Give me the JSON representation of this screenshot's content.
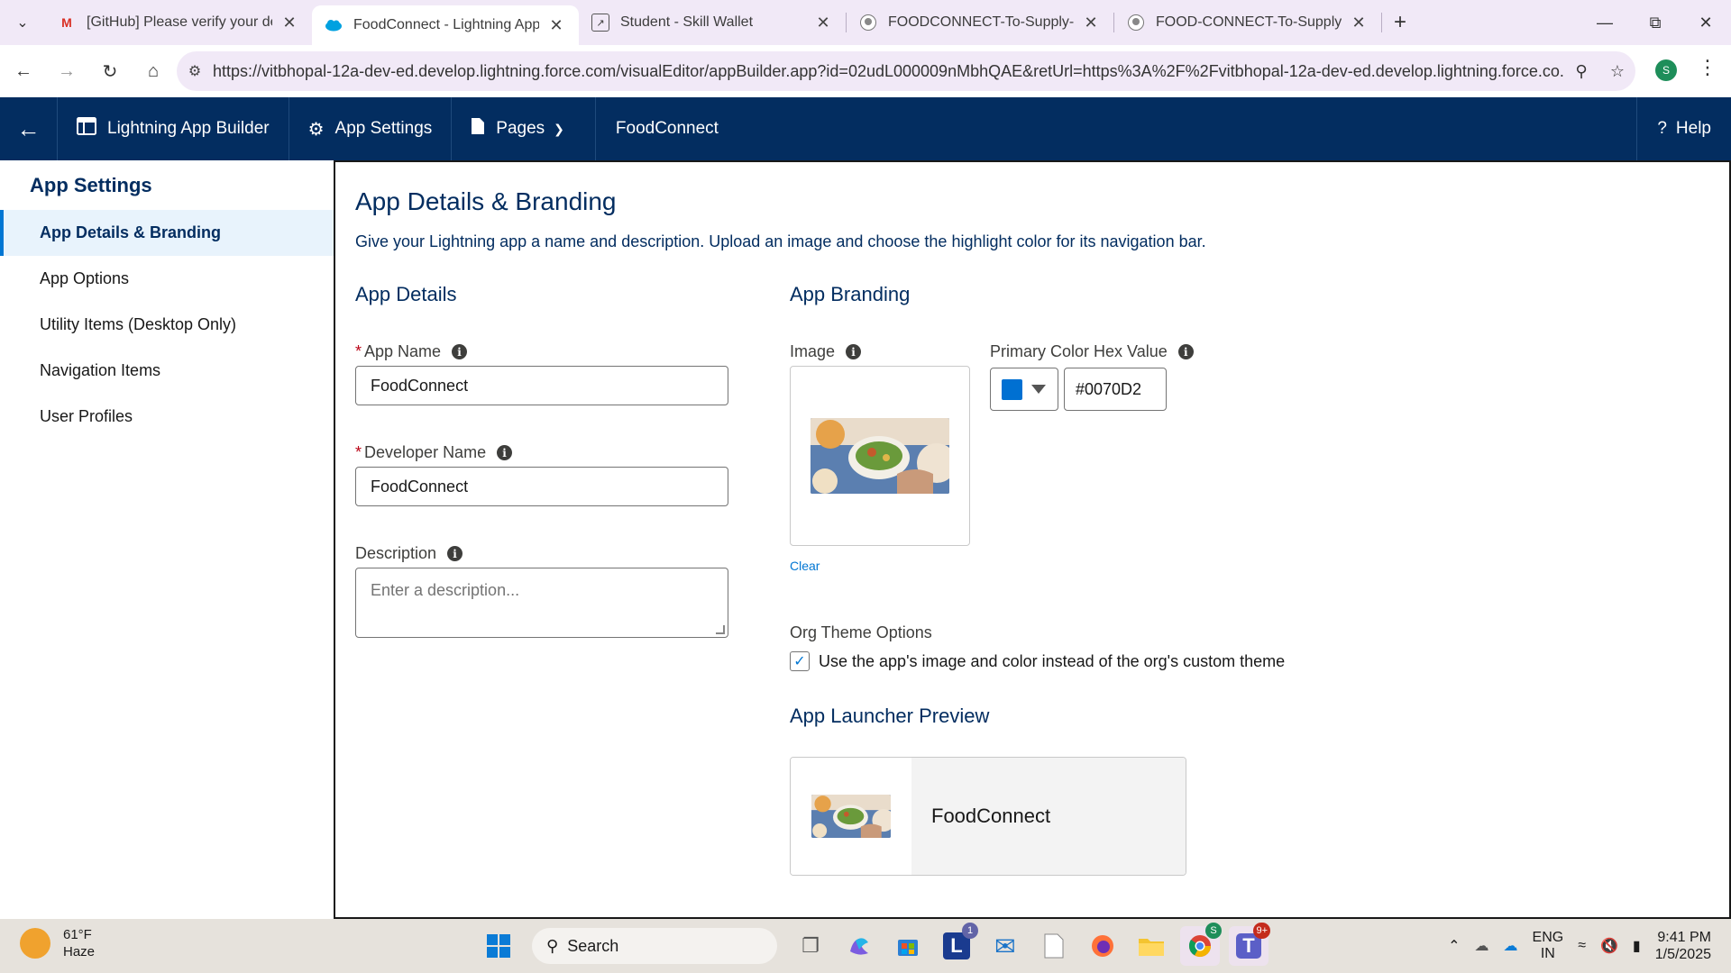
{
  "browser": {
    "tabs": [
      {
        "title": "[GitHub] Please verify your devi",
        "icon": "gmail-icon",
        "active": false
      },
      {
        "title": "FoodConnect - Lightning App B",
        "icon": "salesforce-cloud-icon",
        "active": true
      },
      {
        "title": "Student - Skill Wallet",
        "icon": "skill-wallet-icon",
        "active": false
      },
      {
        "title": "FOODCONNECT-To-Supply-Left",
        "icon": "github-icon",
        "active": false
      },
      {
        "title": "FOOD-CONNECT-To-Supply-Le",
        "icon": "github-icon",
        "active": false
      }
    ],
    "url": "https://vitbhopal-12a-dev-ed.develop.lightning.force.com/visualEditor/appBuilder.app?id=02udL000009nMbhQAE&retUrl=https%3A%2F%2Fvitbhopal-12a-dev-ed.develop.lightning.force.co...",
    "profile_initial": "S"
  },
  "header": {
    "builder_title": "Lightning App Builder",
    "app_settings_label": "App Settings",
    "pages_label": "Pages",
    "app_name": "FoodConnect",
    "help_label": "Help"
  },
  "sidebar": {
    "title": "App Settings",
    "items": [
      {
        "label": "App Details & Branding",
        "active": true
      },
      {
        "label": "App Options",
        "active": false
      },
      {
        "label": "Utility Items (Desktop Only)",
        "active": false
      },
      {
        "label": "Navigation Items",
        "active": false
      },
      {
        "label": "User Profiles",
        "active": false
      }
    ]
  },
  "main": {
    "title": "App Details & Branding",
    "intro": "Give your Lightning app a name and description. Upload an image and choose the highlight color for its navigation bar.",
    "details": {
      "section_title": "App Details",
      "app_name_label": "App Name",
      "app_name_value": "FoodConnect",
      "developer_name_label": "Developer Name",
      "developer_name_value": "FoodConnect",
      "description_label": "Description",
      "description_placeholder": "Enter a description..."
    },
    "branding": {
      "section_title": "App Branding",
      "image_label": "Image",
      "clear_label": "Clear",
      "color_label": "Primary Color Hex Value",
      "color_value": "#0070D2",
      "org_theme_label": "Org Theme Options",
      "org_theme_checkbox_label": "Use the app's image and color instead of the org's custom theme",
      "org_theme_checked": true,
      "preview_title": "App Launcher Preview",
      "preview_app_name": "FoodConnect"
    }
  },
  "taskbar": {
    "weather_temp": "61°F",
    "weather_desc": "Haze",
    "search_label": "Search",
    "lang_line1": "ENG",
    "lang_line2": "IN",
    "time": "9:41 PM",
    "date": "1/5/2025",
    "badges": {
      "teams_l": "1",
      "chrome": "S",
      "teams": "9+"
    }
  }
}
